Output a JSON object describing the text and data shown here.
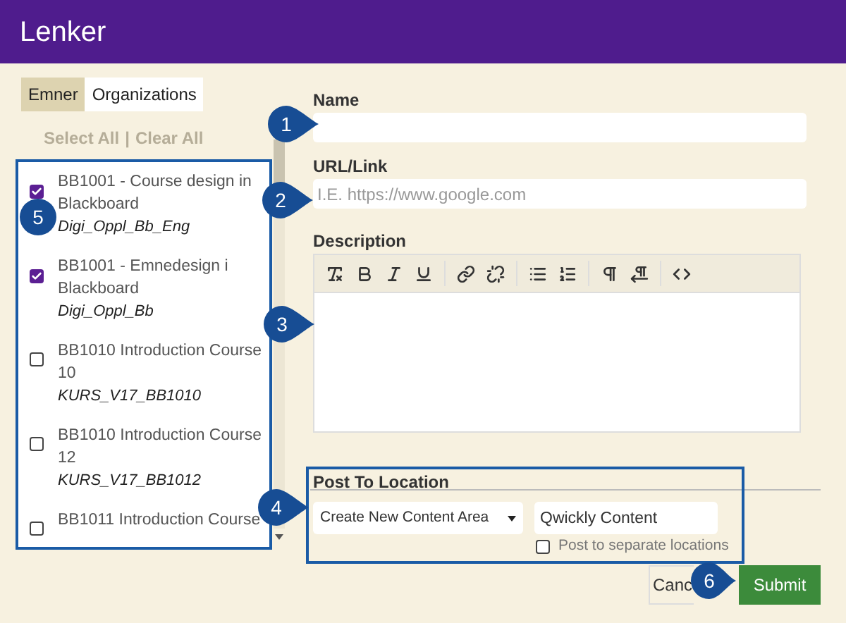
{
  "window": {
    "title": "Lenker"
  },
  "tabs": [
    {
      "label": "Emner",
      "selected": true
    },
    {
      "label": "Organizations",
      "selected": false
    }
  ],
  "select_all": "Select All",
  "separator": "|",
  "clear_all": "Clear All",
  "courses": [
    {
      "title": "BB1001 - Course design in Blackboard",
      "code": "Digi_Oppl_Bb_Eng",
      "checked": true
    },
    {
      "title": "BB1001 - Emnedesign i Blackboard",
      "code": "Digi_Oppl_Bb",
      "checked": true
    },
    {
      "title": "BB1010 Introduction Course 10",
      "code": "KURS_V17_BB1010",
      "checked": false
    },
    {
      "title": "BB1010 Introduction Course 12",
      "code": "KURS_V17_BB1012",
      "checked": false
    },
    {
      "title": "BB1011 Introduction Course",
      "checked": false
    }
  ],
  "form": {
    "name": {
      "label": "Name"
    },
    "url": {
      "label": "URL/Link",
      "placeholder": "I.E. https://www.google.com"
    },
    "description": {
      "label": "Description"
    },
    "post_to_location": {
      "title": "Post To Location",
      "location_select": "Create New Content Area",
      "content_name": "Qwickly Content",
      "separate": {
        "label": "Post to separate locations",
        "checked": false
      }
    }
  },
  "buttons": [
    {
      "label": "Canc",
      "kind": "secondary"
    },
    {
      "label": "Submit",
      "kind": "primary"
    }
  ],
  "callouts": [
    {
      "number": "1"
    },
    {
      "number": "2"
    },
    {
      "number": "3"
    },
    {
      "number": "4"
    },
    {
      "number": "5"
    },
    {
      "number": "6"
    }
  ]
}
